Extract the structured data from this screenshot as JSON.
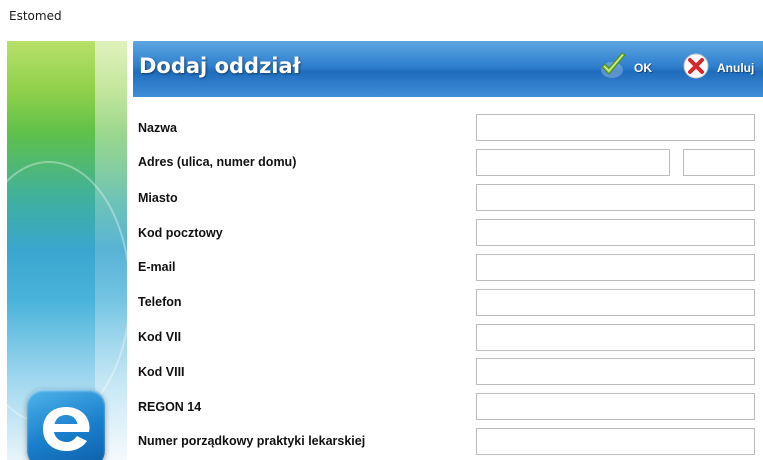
{
  "window": {
    "title": "Estomed"
  },
  "header": {
    "title": "Dodaj oddział",
    "ok_label": "OK",
    "cancel_label": "Anuluj"
  },
  "form": {
    "fields": [
      {
        "label": "Nazwa",
        "value": ""
      },
      {
        "label": "Adres (ulica, numer domu)",
        "street_value": "",
        "number_value": ""
      },
      {
        "label": "Miasto",
        "value": ""
      },
      {
        "label": "Kod pocztowy",
        "value": ""
      },
      {
        "label": "E-mail",
        "value": ""
      },
      {
        "label": "Telefon",
        "value": ""
      },
      {
        "label": "Kod VII",
        "value": ""
      },
      {
        "label": "Kod VIII",
        "value": ""
      },
      {
        "label": "REGON 14",
        "value": ""
      },
      {
        "label": "Numer porządkowy praktyki lekarskiej",
        "value": ""
      }
    ]
  },
  "icons": {
    "ok": "checkmark-icon",
    "cancel": "close-icon",
    "logo": "estomed-logo-icon"
  },
  "colors": {
    "header_blue": "#2f7fcf",
    "ok_green": "#8cc63f",
    "cancel_red": "#d9262b"
  }
}
